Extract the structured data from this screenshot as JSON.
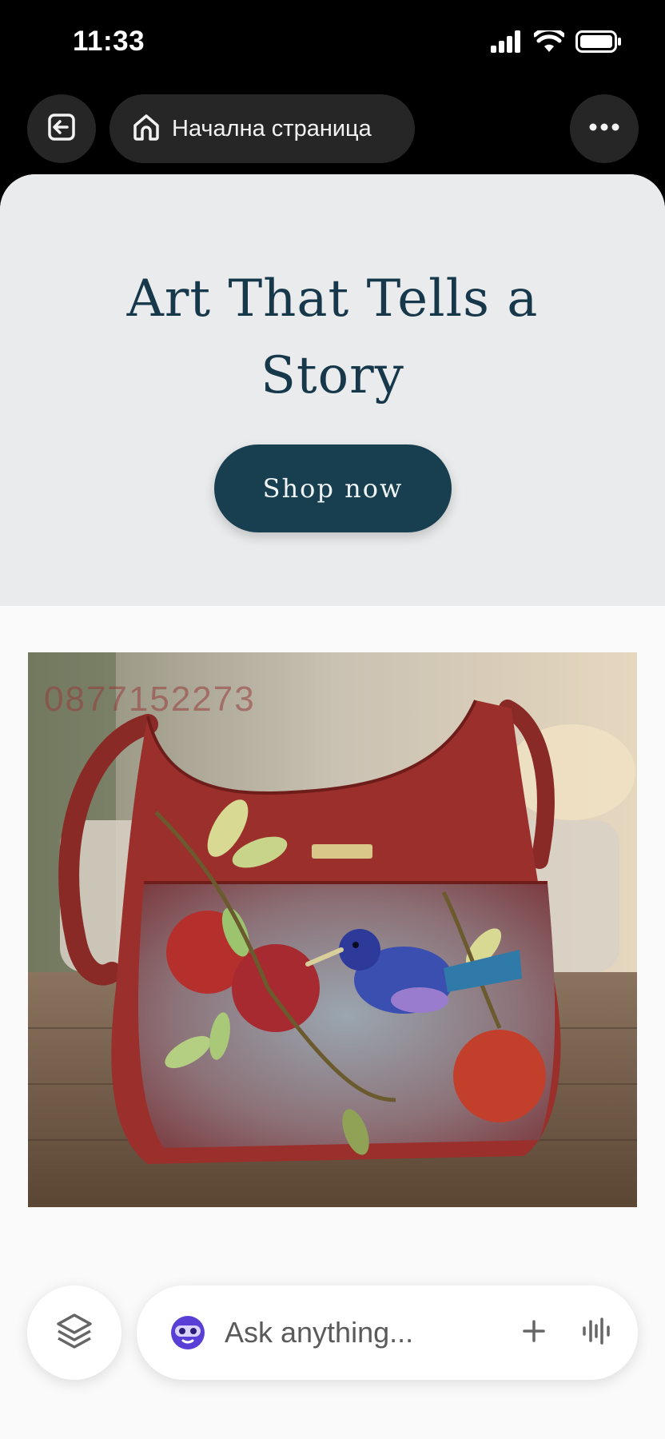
{
  "status_bar": {
    "time": "11:33",
    "icons": [
      "cellular-signal-icon",
      "wifi-icon",
      "battery-icon"
    ]
  },
  "toolbar": {
    "exit_icon": "exit-tab-icon",
    "home_icon": "home-icon",
    "home_label": "Начална страница",
    "more_icon": "more-dots-icon"
  },
  "hero": {
    "title": "Art That Tells a Story",
    "button_label": "Shop now",
    "background": "#e9ebed",
    "title_color": "#17384a",
    "button_color": "#173f4f"
  },
  "product": {
    "watermark": "0877152273",
    "image_subject": "hand-painted-red-leather-handbag"
  },
  "assistant_bar": {
    "layers_icon": "layers-icon",
    "avatar_icon": "assistant-avatar-icon",
    "placeholder": "Ask anything...",
    "plus_icon": "plus-icon",
    "voice_icon": "voice-wave-icon"
  },
  "colors": {
    "chrome": "#000000",
    "pill": "#262626",
    "page": "#fafafa"
  }
}
